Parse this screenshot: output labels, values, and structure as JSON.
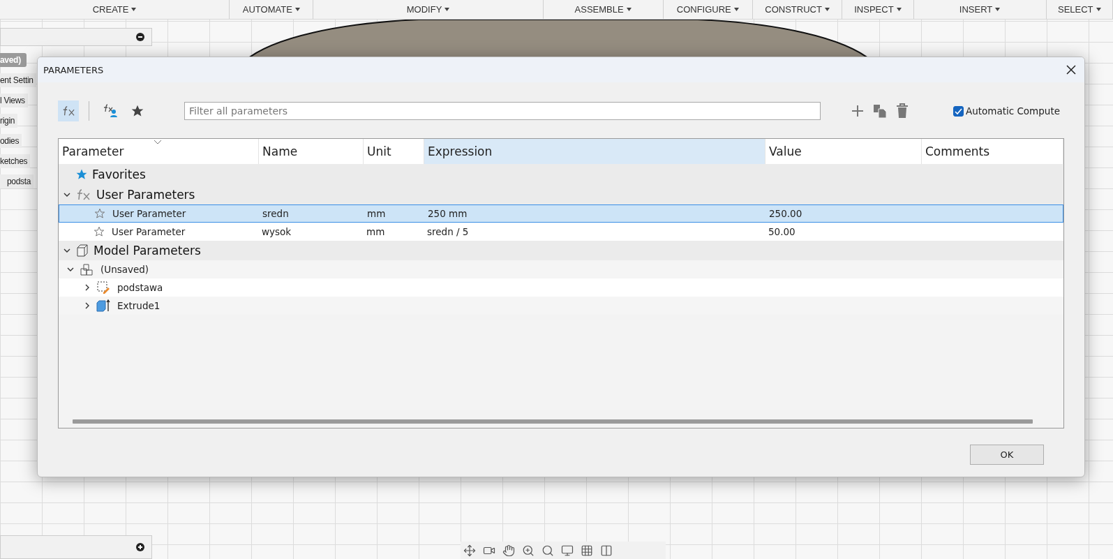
{
  "menu_bar": [
    {
      "label": "CREATE"
    },
    {
      "label": "AUTOMATE"
    },
    {
      "label": "MODIFY"
    },
    {
      "label": "ASSEMBLE"
    },
    {
      "label": "CONFIGURE"
    },
    {
      "label": "CONSTRUCT"
    },
    {
      "label": "INSPECT"
    },
    {
      "label": "INSERT"
    },
    {
      "label": "SELECT"
    }
  ],
  "browser": {
    "root": "aved)",
    "items": [
      "ent Settin",
      "l Views",
      "rigin",
      "odies",
      "ketches",
      "podsta"
    ]
  },
  "dialog": {
    "title": "PARAMETERS",
    "filters": [
      {
        "kind": "all",
        "selected": true
      },
      {
        "kind": "user",
        "selected": false
      },
      {
        "kind": "favorites",
        "selected": false
      }
    ],
    "search": {
      "placeholder": "Filter all parameters"
    },
    "automatic_compute": {
      "label": "Automatic Compute",
      "checked": true
    },
    "columns": [
      {
        "label": "Parameter",
        "selected": false
      },
      {
        "label": "Name",
        "selected": false
      },
      {
        "label": "Unit",
        "selected": false
      },
      {
        "label": "Expression",
        "selected": true
      },
      {
        "label": "Value",
        "selected": false
      },
      {
        "label": "Comments",
        "selected": false
      }
    ],
    "tree": [
      {
        "kind": "favorites",
        "label": "Favorites"
      },
      {
        "kind": "user",
        "label": "User Parameters",
        "expanded": true,
        "children": [
          {
            "kind": "param",
            "favorite": false,
            "selected": true,
            "cells": [
              "User Parameter",
              "sredn",
              "mm",
              "250 mm",
              "250.00"
            ]
          },
          {
            "kind": "param",
            "favorite": false,
            "selected": false,
            "cells": [
              "User Parameter",
              "wysok",
              "mm",
              "sredn / 5",
              "50.00"
            ]
          }
        ]
      },
      {
        "kind": "model",
        "label": "Model Parameters",
        "expanded": true,
        "children": [
          {
            "kind": "component",
            "label": "(Unsaved)",
            "expanded": true,
            "children": [
              {
                "kind": "sketch",
                "label": "podstawa",
                "expanded": false
              },
              {
                "kind": "feature",
                "label": "Extrude1",
                "expanded": false
              }
            ]
          }
        ]
      }
    ],
    "ok_button": "OK"
  }
}
